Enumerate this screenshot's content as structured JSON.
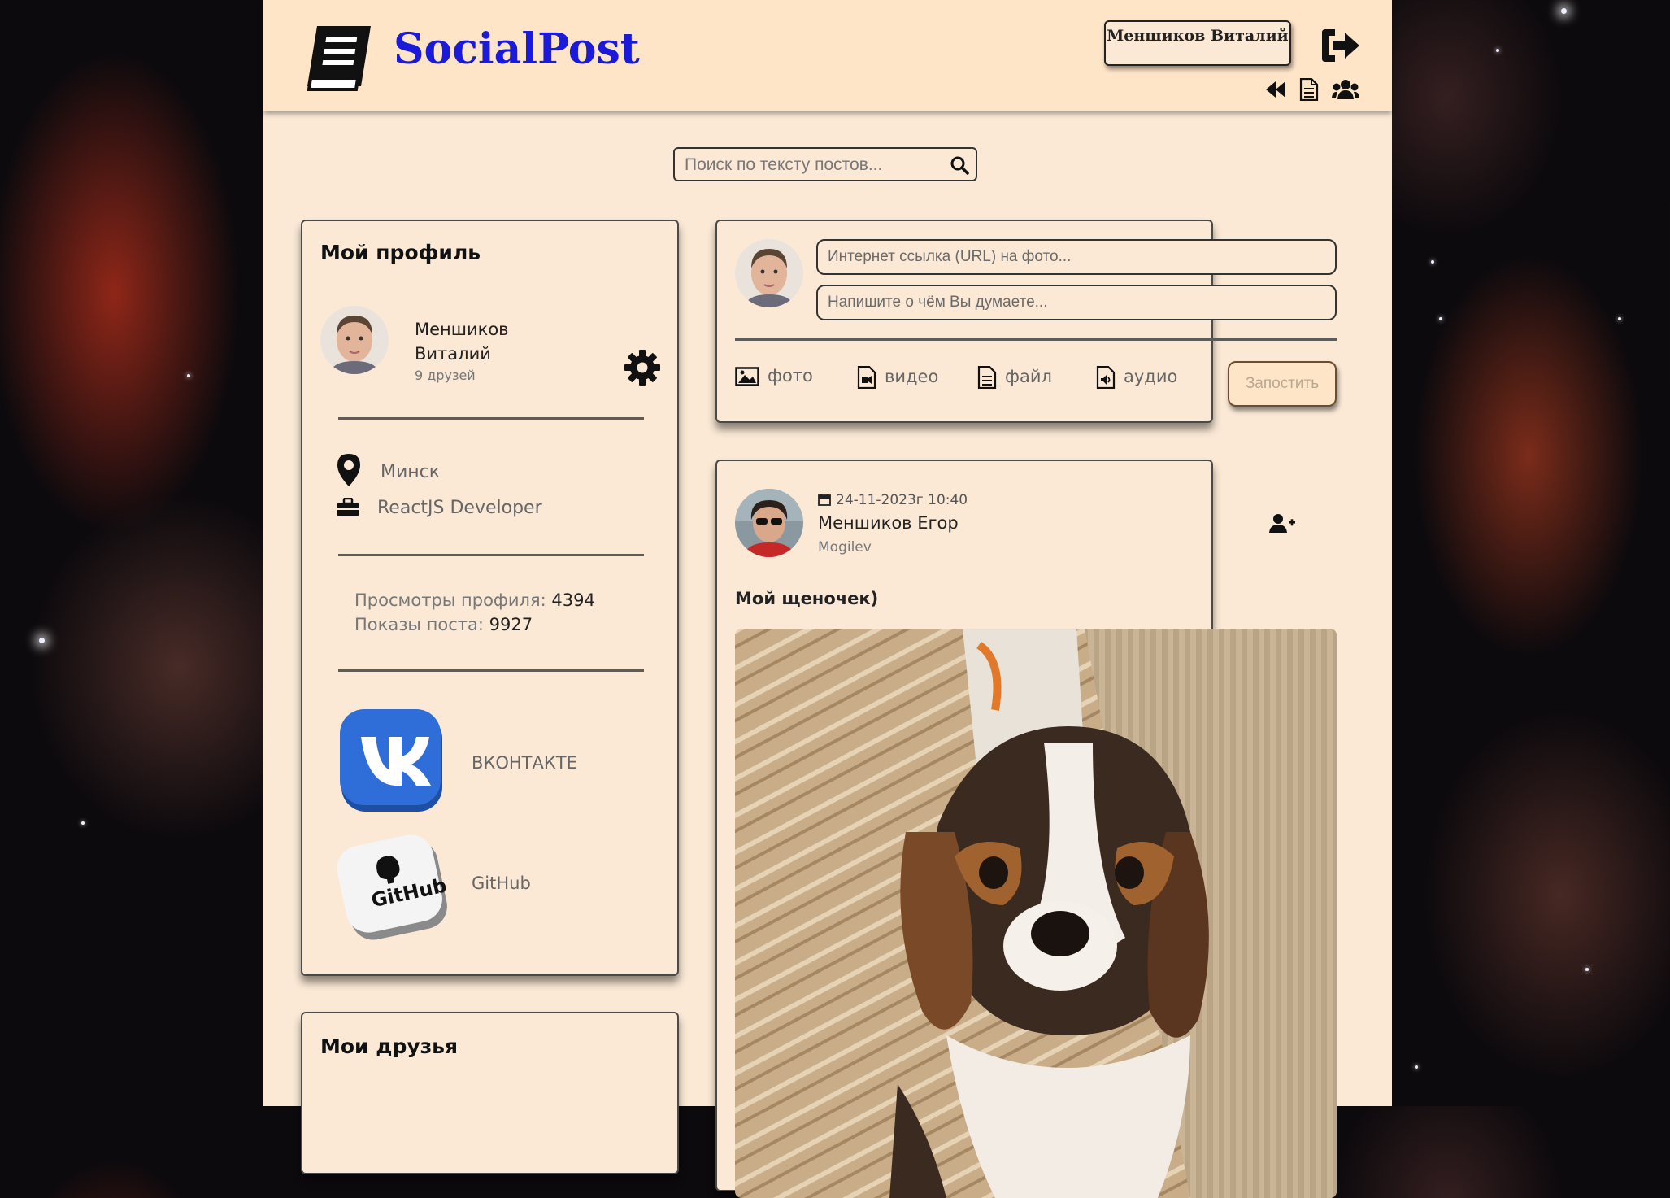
{
  "app": {
    "title": "SocialPost"
  },
  "header": {
    "user_name": "Меншиков Виталий",
    "icons": [
      "book-icon",
      "logout-icon",
      "rewind-icon",
      "document-icon",
      "users-icon"
    ]
  },
  "search": {
    "placeholder": "Поиск по тексту постов..."
  },
  "profile": {
    "title": "Мой профиль",
    "name": "Меншиков Виталий",
    "friends_count": "9 друзей",
    "city": "Минск",
    "job": "ReactJS Developer",
    "views_label": "Просмотры профиля:",
    "views_value": "4394",
    "impressions_label": "Показы поста:",
    "impressions_value": "9927",
    "links": [
      {
        "label": "ВКОНТАКТЕ",
        "icon": "vk-icon",
        "color": "#2f6ed8"
      },
      {
        "label": "GitHub",
        "icon": "github-icon",
        "color": "#f4f4f4"
      }
    ]
  },
  "friends": {
    "title": "Мои друзья"
  },
  "composer": {
    "photo_url_placeholder": "Интернет ссылка (URL) на фото...",
    "text_placeholder": "Напишите о чём Вы думаете...",
    "attachments": [
      {
        "label": "фото",
        "icon": "image-icon"
      },
      {
        "label": "видео",
        "icon": "video-file-icon"
      },
      {
        "label": "файл",
        "icon": "file-icon"
      },
      {
        "label": "аудио",
        "icon": "audio-file-icon"
      }
    ],
    "submit_label": "Запостить"
  },
  "post": {
    "date": "24-11-2023г 10:40",
    "author": "Меншиков Егор",
    "city": "Mogilev",
    "text": "Мой щеночек)",
    "image": "beagle-puppy-photo"
  },
  "colors": {
    "header_bg": "#ffe5c8",
    "page_bg": "#fbe9d6",
    "brand": "#1a1ad8"
  }
}
